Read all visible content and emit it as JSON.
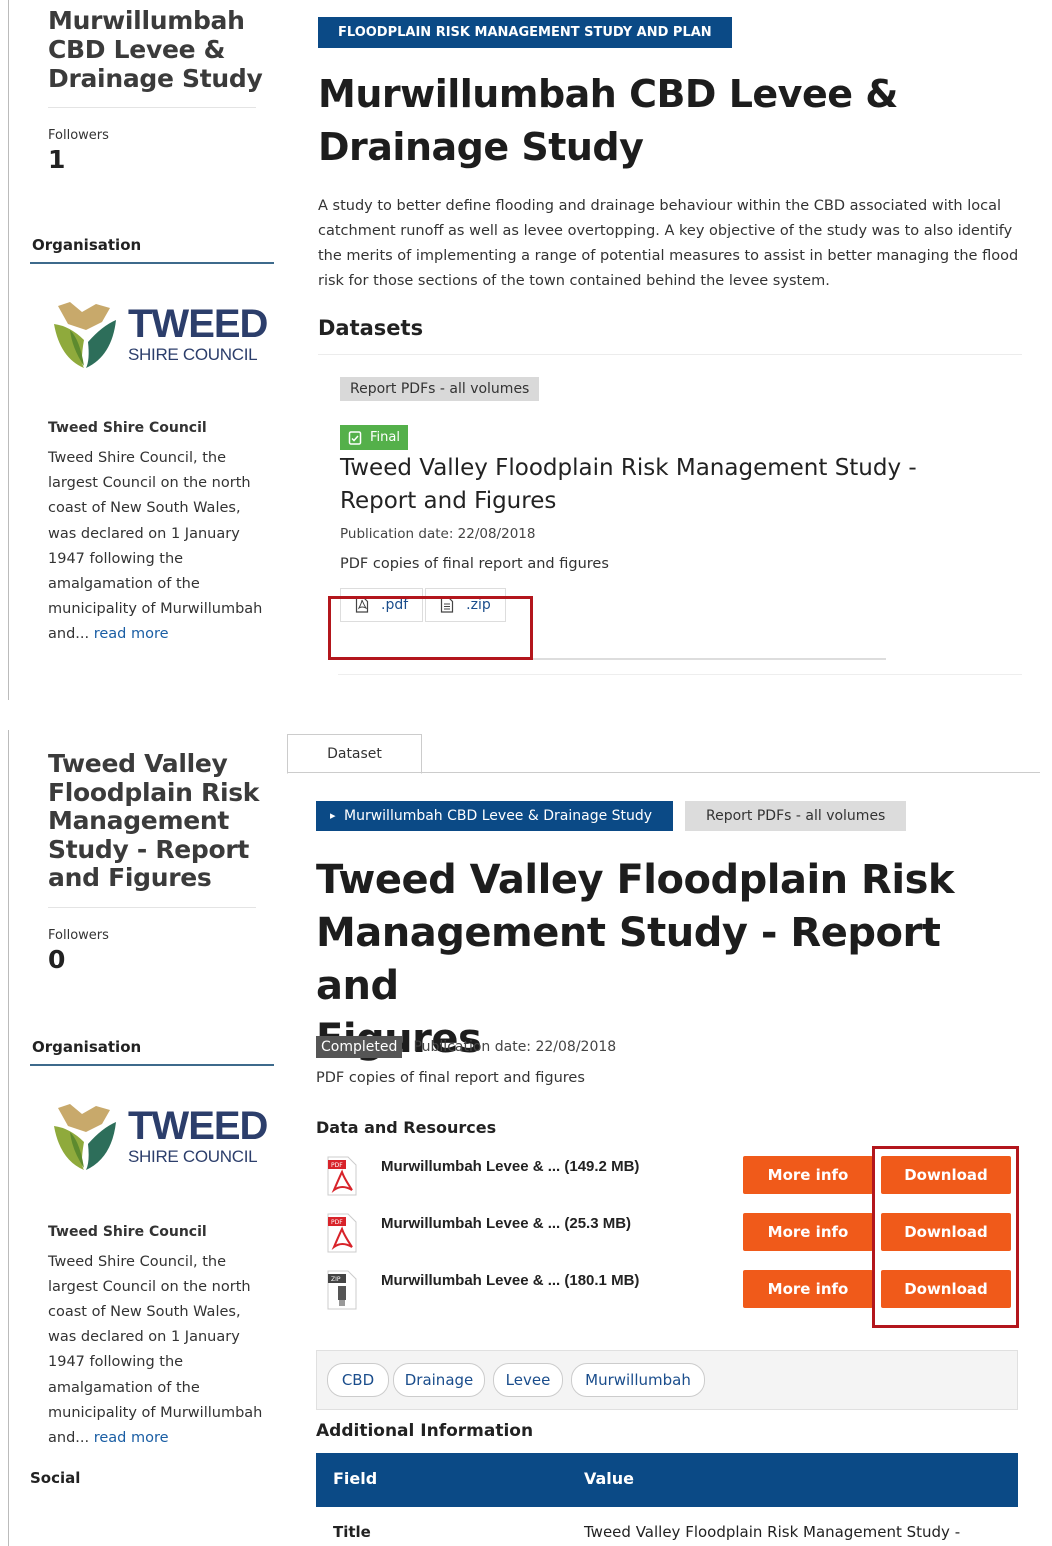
{
  "panel1": {
    "sidebar": {
      "title_lines": [
        "Murwillumbah",
        "CBD Levee &",
        "Drainage Study"
      ],
      "followers_label": "Followers",
      "followers_count": "1",
      "organisation_heading": "Organisation",
      "logo_main": "TWEED",
      "logo_sub": "SHIRE COUNCIL",
      "org_name": "Tweed Shire Council",
      "org_description": "Tweed Shire Council, the largest Council on the north coast of New South Wales, was declared on 1 January 1947 following the amalgamation of the municipality of Murwillumbah and...",
      "read_more": "read more"
    },
    "main": {
      "category_tag": "FLOODPLAIN RISK MANAGEMENT STUDY AND PLAN",
      "title_lines": [
        "Murwillumbah CBD Levee &",
        "Drainage Study"
      ],
      "description": "A study to better define flooding and drainage behaviour within the CBD associated with local catchment runoff as well as levee overtopping. A key objective of the study was to also identify the merits of implementing a range of potential measures to assist in better managing the flood risk for those sections of the town contained behind the levee system.",
      "datasets_heading": "Datasets",
      "dataset": {
        "group_tag": "Report PDFs - all volumes",
        "status": "Final",
        "title_lines": [
          "Tweed Valley Floodplain Risk Management Study -",
          "Report and Figures"
        ],
        "publication_date": "Publication date: 22/08/2018",
        "summary": "PDF copies of final report and figures",
        "formats": [
          ".pdf",
          ".zip"
        ]
      }
    }
  },
  "panel2": {
    "tab_label": "Dataset",
    "sidebar": {
      "title_lines": [
        "Tweed Valley",
        "Floodplain Risk",
        "Management",
        "Study - Report",
        "and Figures"
      ],
      "followers_label": "Followers",
      "followers_count": "0",
      "organisation_heading": "Organisation",
      "logo_main": "TWEED",
      "logo_sub": "SHIRE COUNCIL",
      "org_name": "Tweed Shire Council",
      "org_description": "Tweed Shire Council, the largest Council on the north coast of New South Wales, was declared on 1 January 1947 following the amalgamation of the municipality of Murwillumbah and...",
      "read_more": "read more",
      "social_heading": "Social"
    },
    "main": {
      "breadcrumb_parent": "Murwillumbah CBD Levee & Drainage Study",
      "breadcrumb_group": "Report PDFs - all volumes",
      "title_lines": [
        "Tweed Valley Floodplain Risk",
        "Management Study - Report and",
        "Figures"
      ],
      "status_badge": "Completed",
      "publication_date": "Publication date: 22/08/2018",
      "summary": "PDF copies of final report and figures",
      "resources_heading": "Data and Resources",
      "resources": [
        {
          "name": "Murwillumbah Levee & ... (149.2 MB)",
          "icon": "pdf-file-icon",
          "more_info": "More info",
          "download": "Download"
        },
        {
          "name": "Murwillumbah Levee & ... (25.3 MB)",
          "icon": "pdf-file-icon",
          "more_info": "More info",
          "download": "Download"
        },
        {
          "name": "Murwillumbah Levee & ... (180.1 MB)",
          "icon": "zip-file-icon",
          "more_info": "More info",
          "download": "Download"
        }
      ],
      "tags": [
        "CBD",
        "Drainage",
        "Levee",
        "Murwillumbah"
      ],
      "additional_heading": "Additional Information",
      "table": {
        "headers": [
          "Field",
          "Value"
        ],
        "rows": [
          [
            "Title",
            "Tweed Valley Floodplain Risk Management Study -"
          ]
        ]
      }
    }
  },
  "colors": {
    "brand_blue": "#0b4a86",
    "orange_button": "#f05a1a",
    "green_status": "#54b04a",
    "highlight_red": "#b3161c"
  }
}
